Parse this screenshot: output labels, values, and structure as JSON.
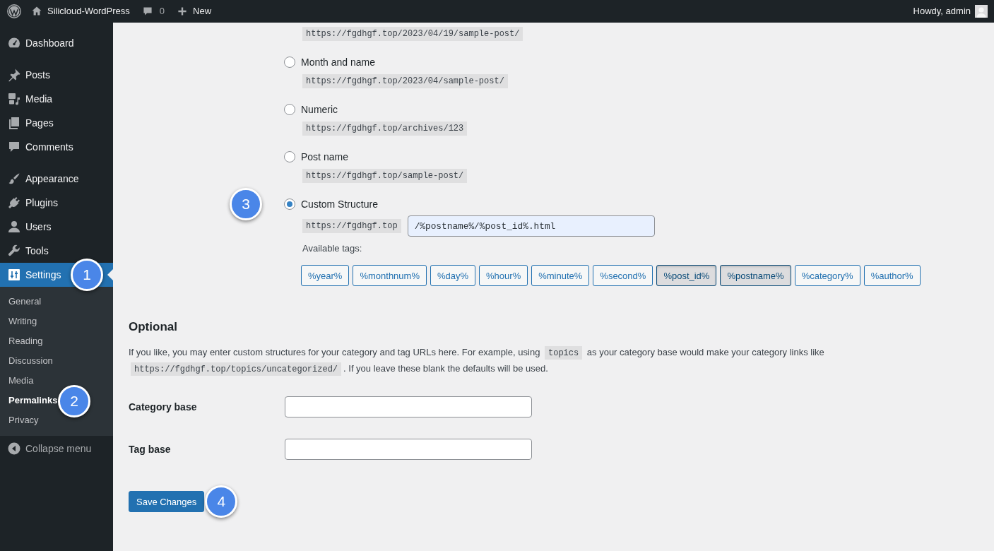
{
  "admin_bar": {
    "site_name": "Silicloud-WordPress",
    "comments_count": "0",
    "new_label": "New",
    "greeting": "Howdy, admin"
  },
  "sidebar": {
    "groups": [
      {
        "items": [
          {
            "label": "Dashboard",
            "selected": false
          }
        ]
      },
      {
        "items": [
          {
            "label": "Posts",
            "selected": false
          },
          {
            "label": "Media",
            "selected": false
          },
          {
            "label": "Pages",
            "selected": false
          },
          {
            "label": "Comments",
            "selected": false
          }
        ]
      },
      {
        "items": [
          {
            "label": "Appearance",
            "selected": false
          },
          {
            "label": "Plugins",
            "selected": false
          },
          {
            "label": "Users",
            "selected": false
          },
          {
            "label": "Tools",
            "selected": false
          },
          {
            "label": "Settings",
            "selected": true,
            "callout": "1",
            "submenu": [
              {
                "label": "General",
                "selected": false
              },
              {
                "label": "Writing",
                "selected": false
              },
              {
                "label": "Reading",
                "selected": false
              },
              {
                "label": "Discussion",
                "selected": false
              },
              {
                "label": "Media",
                "selected": false
              },
              {
                "label": "Permalinks",
                "selected": true,
                "callout": "2"
              },
              {
                "label": "Privacy",
                "selected": false
              }
            ]
          }
        ]
      }
    ],
    "collapse_label": "Collapse menu"
  },
  "permalinks": {
    "top_example": "https://fgdhgf.top/2023/04/19/sample-post/",
    "options": [
      {
        "kind": "preset",
        "label": "Month and name",
        "example": "https://fgdhgf.top/2023/04/sample-post/",
        "selected": false
      },
      {
        "kind": "preset",
        "label": "Numeric",
        "example": "https://fgdhgf.top/archives/123",
        "selected": false
      },
      {
        "kind": "preset",
        "label": "Post name",
        "example": "https://fgdhgf.top/sample-post/",
        "selected": false
      },
      {
        "kind": "custom",
        "label": "Custom Structure",
        "selected": true,
        "callout": "3",
        "prefix": "https://fgdhgf.top",
        "value": "/%postname%/%post_id%.html",
        "tags_label": "Available tags:",
        "tags": [
          {
            "label": "%year%",
            "selected": false
          },
          {
            "label": "%monthnum%",
            "selected": false
          },
          {
            "label": "%day%",
            "selected": false
          },
          {
            "label": "%hour%",
            "selected": false
          },
          {
            "label": "%minute%",
            "selected": false
          },
          {
            "label": "%second%",
            "selected": false
          },
          {
            "label": "%post_id%",
            "selected": true
          },
          {
            "label": "%postname%",
            "selected": true
          },
          {
            "label": "%category%",
            "selected": false
          },
          {
            "label": "%author%",
            "selected": false
          }
        ]
      }
    ]
  },
  "optional": {
    "heading": "Optional",
    "description": [
      {
        "kind": "text",
        "text": "If you like, you may enter custom structures for your category and tag URLs here. For example, using "
      },
      {
        "kind": "code",
        "text": "topics"
      },
      {
        "kind": "text",
        "text": " as your category base would make your category links like "
      },
      {
        "kind": "code",
        "text": "https://fgdhgf.top/topics/uncategorized/"
      },
      {
        "kind": "text",
        "text": ". If you leave these blank the defaults will be used."
      }
    ],
    "fields": [
      {
        "label": "Category base"
      },
      {
        "label": "Tag base"
      }
    ]
  },
  "save_button": {
    "label": "Save Changes",
    "callout": "4"
  }
}
